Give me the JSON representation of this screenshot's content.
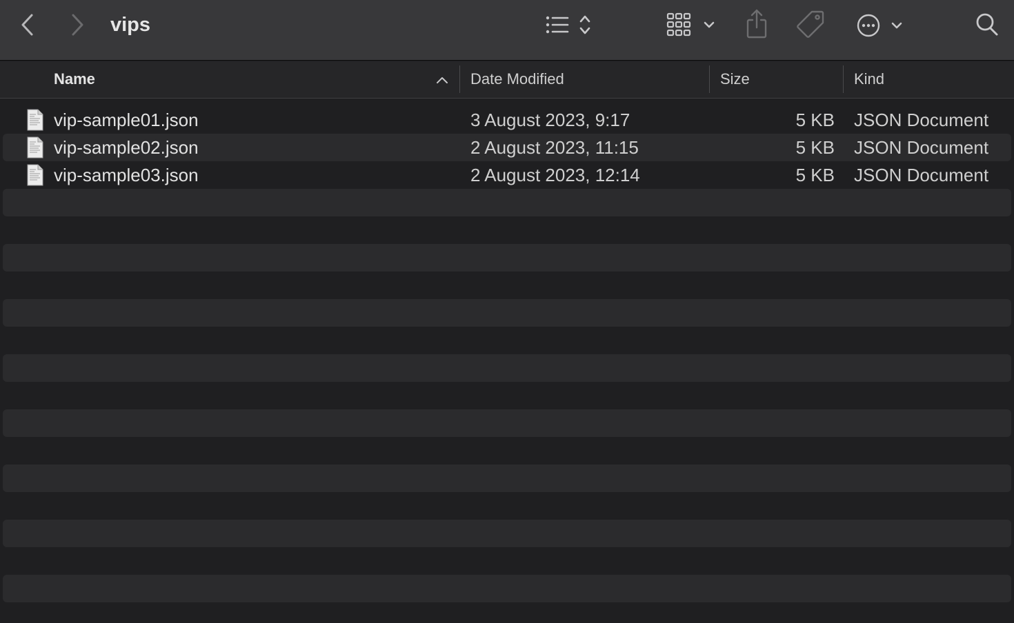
{
  "window": {
    "folder_title": "vips"
  },
  "toolbar": {
    "icons": [
      "chevron-left-icon",
      "chevron-right-icon",
      "list-view-icon",
      "sort-updown-icon",
      "icon-grid-icon",
      "chevron-down-icon",
      "share-icon",
      "tag-icon",
      "ellipsis-circle-icon",
      "search-icon"
    ]
  },
  "columns": {
    "name": "Name",
    "date": "Date Modified",
    "size": "Size",
    "kind": "Kind",
    "sort_direction": "ascending"
  },
  "files": [
    {
      "name": "vip-sample01.json",
      "date": "3 August 2023, 9:17",
      "size": "5 KB",
      "kind": "JSON Document"
    },
    {
      "name": "vip-sample02.json",
      "date": "2 August 2023, 11:15",
      "size": "5 KB",
      "kind": "JSON Document"
    },
    {
      "name": "vip-sample03.json",
      "date": "2 August 2023, 12:14",
      "size": "5 KB",
      "kind": "JSON Document"
    }
  ],
  "colors": {
    "toolbar_bg": "#38383a",
    "list_bg": "#1f1f21",
    "stripe_bg": "#2b2b2d",
    "text": "#e2e2e2"
  }
}
